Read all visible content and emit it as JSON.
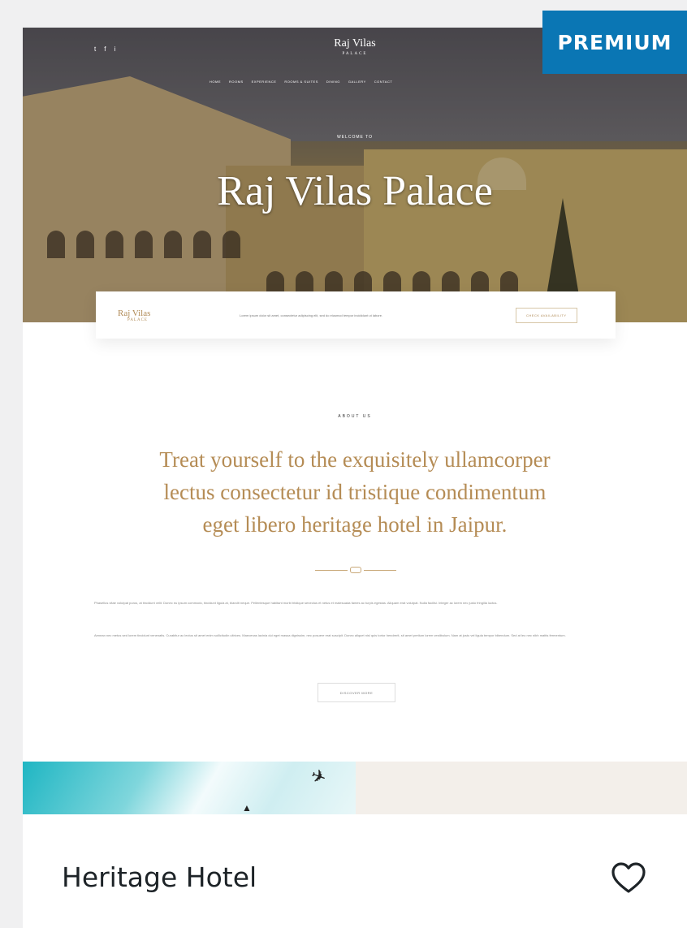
{
  "badge": {
    "label": "PREMIUM"
  },
  "preview": {
    "social_icons": [
      "twitter-icon",
      "facebook-icon",
      "instagram-icon"
    ],
    "social_glyphs": [
      "t",
      "f",
      "i"
    ],
    "brand": {
      "name": "Raj Vilas",
      "sub": "PALACE"
    },
    "nav": [
      "HOME",
      "ROOMS",
      "EXPERIENCE",
      "ROOMS & SUITES",
      "DINING",
      "GALLERY",
      "CONTACT"
    ],
    "welcome": "WELCOME TO",
    "hero_title": "Raj Vilas Palace",
    "bar": {
      "logo": "Raj Vilas",
      "logo_sub": "PALACE",
      "text": "Lorem ipsum dolor sit amet, consectetur adipiscing elit, sed do eiusmod tempor incididunt ut labore.",
      "button": "CHECK AVAILABILITY"
    },
    "about_kicker": "ABOUT US",
    "about_heading_lines": [
      "Treat yourself to the exquisitely ullamcorper",
      "lectus consectetur id tristique condimentum",
      "eget libero heritage hotel in Jaipur."
    ],
    "paragraph_1": "Phasellus vitae volutpat purus, at tincidunt velit. Donec eu ipsum commodo, tincidunt ligula at, blandit neque. Pellentesque habitant morbi tristique senectus et netus et malesuada fames ac turpis egestas. Aliquam erat volutpat. Nulla facilisi. Integer ac lorem nec justo fringilla luctus.",
    "paragraph_2": "Aenean nec metus sed lorem tincidunt venenatis. Curabitur ac lectus sit amet enim sollicitudin ultrices. Maecenas lacinia dui eget massa dignissim, nec posuere erat suscipit. Donec aliquet nisl quis tortor hendrerit, sit amet pretium lorem vestibulum. Nam at justo vel ligula tempor bibendum. Sed at leo nec nibh mattis fermentum.",
    "more_button": "DISCOVER MORE"
  },
  "theme": {
    "name": "Heritage Hotel",
    "favorite_icon": "heart-icon"
  },
  "colors": {
    "badge": "#0a76b4",
    "gold": "#b58c55",
    "page_bg": "#f0f0f1"
  }
}
